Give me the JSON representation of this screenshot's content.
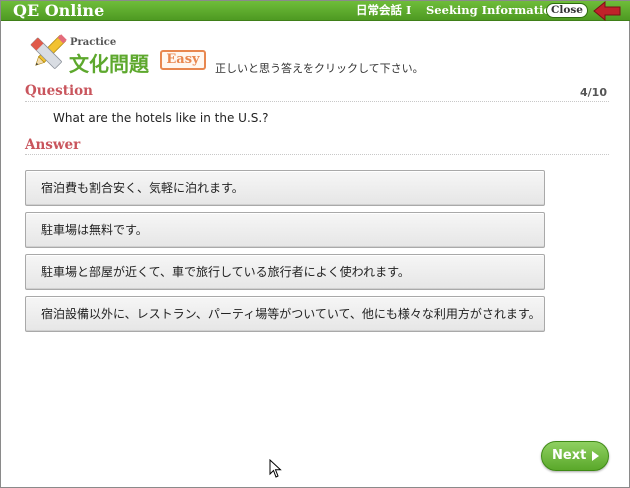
{
  "header": {
    "app_title": "QE Online",
    "breadcrumb_course": "日常会話 I",
    "breadcrumb_topic": "Seeking Information",
    "close_label": "Close"
  },
  "practice": {
    "small_label": "Practice",
    "title": "文化問題",
    "level": "Easy",
    "instruction": "正しいと思う答えをクリックして下さい。"
  },
  "question": {
    "label": "Question",
    "progress": "4/10",
    "text": "What are the hotels like in the U.S.?"
  },
  "answer": {
    "label": "Answer",
    "options": [
      "宿泊費も割合安く、気軽に泊れます。",
      "駐車場は無料です。",
      "駐車場と部屋が近くて、車で旅行している旅行者によく使われます。",
      "宿泊設備以外に、レストラン、パーティ場等がついていて、他にも様々な利用方がされます。"
    ]
  },
  "footer": {
    "next_label": "Next"
  },
  "colors": {
    "header_green": "#5da82d",
    "section_red": "#c9555d",
    "badge_orange": "#e8874f",
    "back_arrow": "#c0222a"
  },
  "icons": {
    "back": "back-arrow-icon",
    "practice": "pencil-eraser-icon",
    "next": "play-triangle-icon",
    "pointer": "mouse-cursor-icon"
  }
}
